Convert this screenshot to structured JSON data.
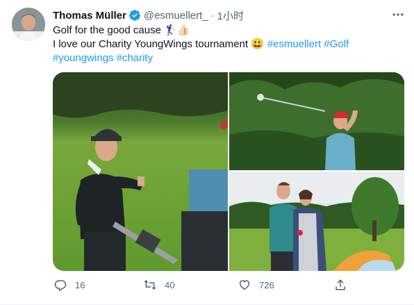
{
  "tweet": {
    "author_name": "Thomas Müller",
    "handle": "@esmuellert_",
    "separator": "·",
    "time": "1小时",
    "line1": "Golf for the good cause",
    "line1_emoji": "🏌️‍♀️👍🏻",
    "line2_text": "I love our Charity YoungWings tournament",
    "line2_emoji": "😃",
    "hashtags": [
      "#esmuellert",
      "#Golf",
      "#youngwings",
      "#charity"
    ]
  },
  "actions": {
    "replies": "16",
    "retweets": "40",
    "likes": "726"
  },
  "colors": {
    "link": "#1d9bf0",
    "secondary_text": "#536471",
    "verified": "#1d9bf0"
  }
}
